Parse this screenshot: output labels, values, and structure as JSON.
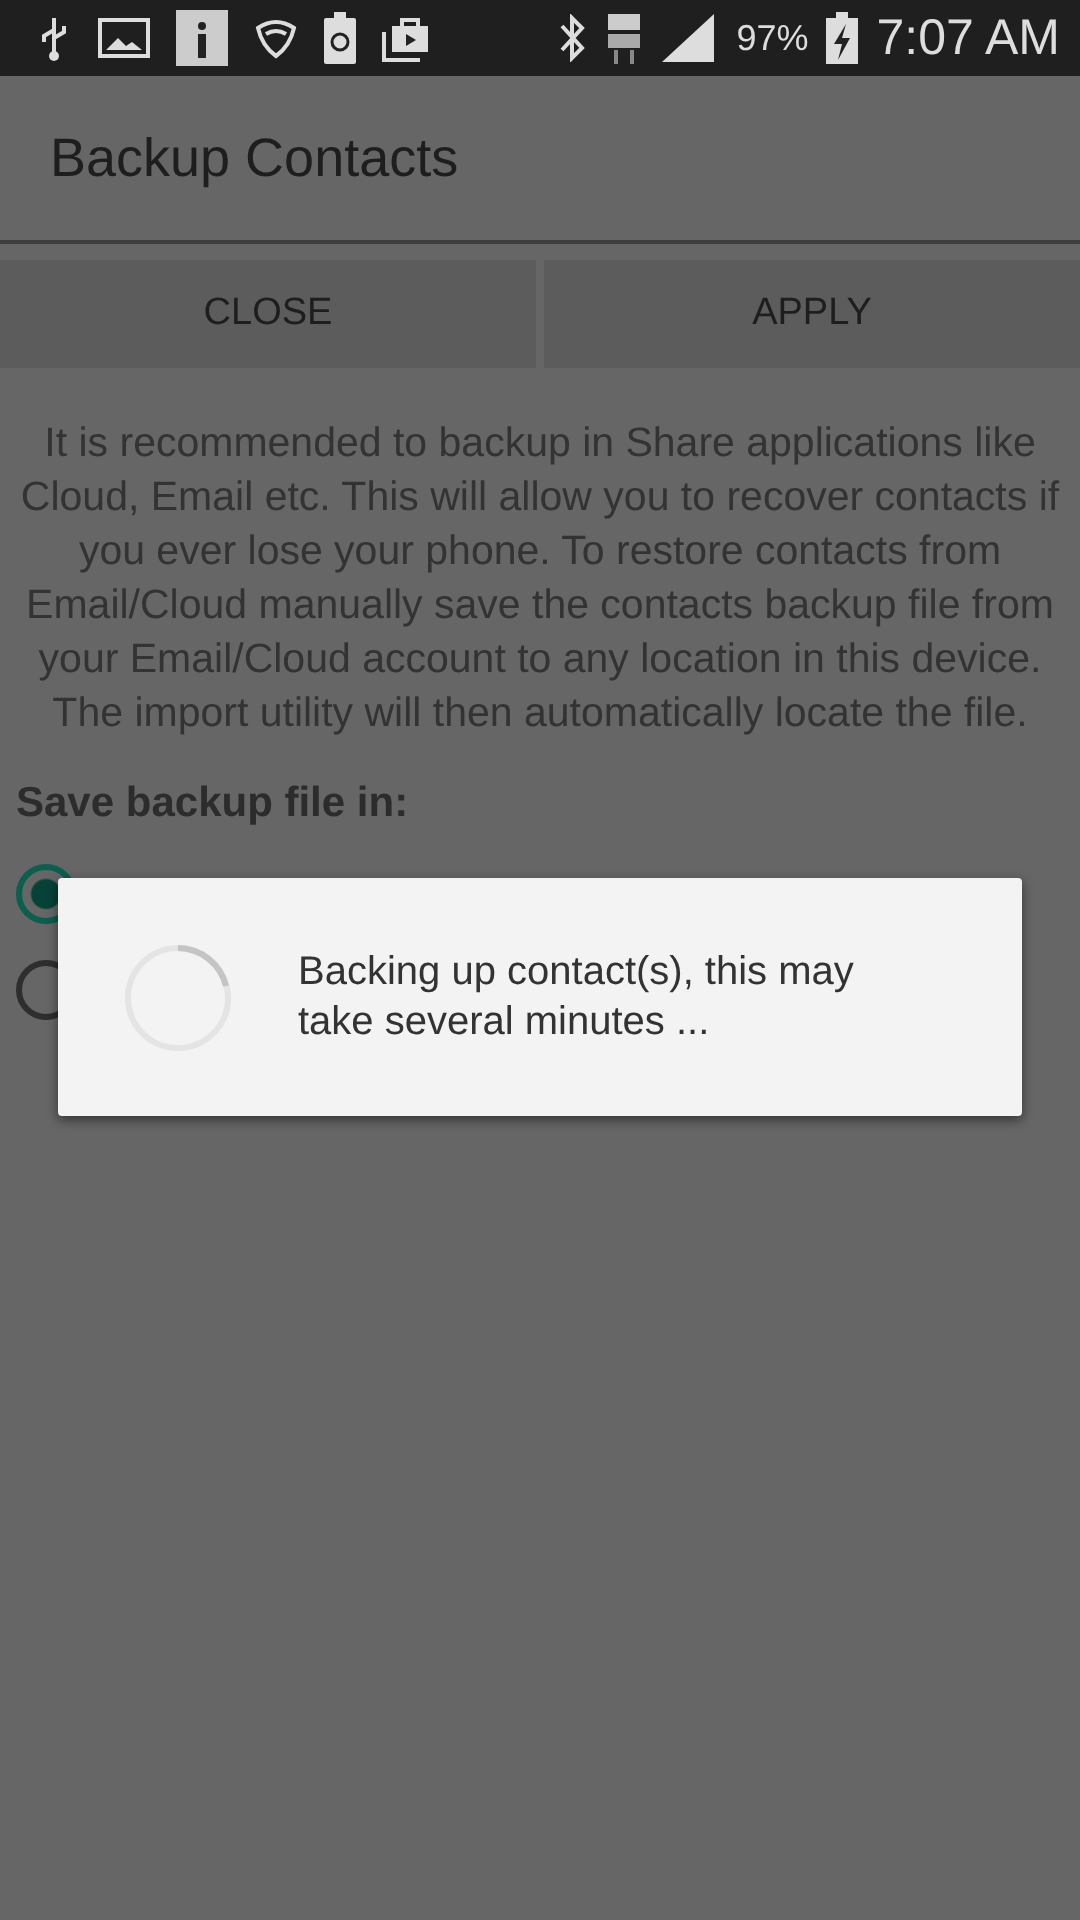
{
  "status_bar": {
    "battery_percent": "97%",
    "time": "7:07 AM"
  },
  "app_bar": {
    "title": "Backup Contacts"
  },
  "buttons": [
    {
      "label": "CLOSE"
    },
    {
      "label": "APPLY"
    }
  ],
  "description": "It is recommended to backup in Share applications like Cloud, Email etc. This will allow you to recover contacts if you ever lose your phone. To restore contacts from Email/Cloud manually save the contacts backup file from your Email/Cloud account to any location in this device. The import utility will then automatically locate the file.",
  "save_location": {
    "heading": "Save backup file in:",
    "options": [
      {
        "selected": true
      },
      {
        "selected": false
      }
    ]
  },
  "progress_dialog": {
    "message": "Backing up contact(s), this may take several minutes ..."
  }
}
